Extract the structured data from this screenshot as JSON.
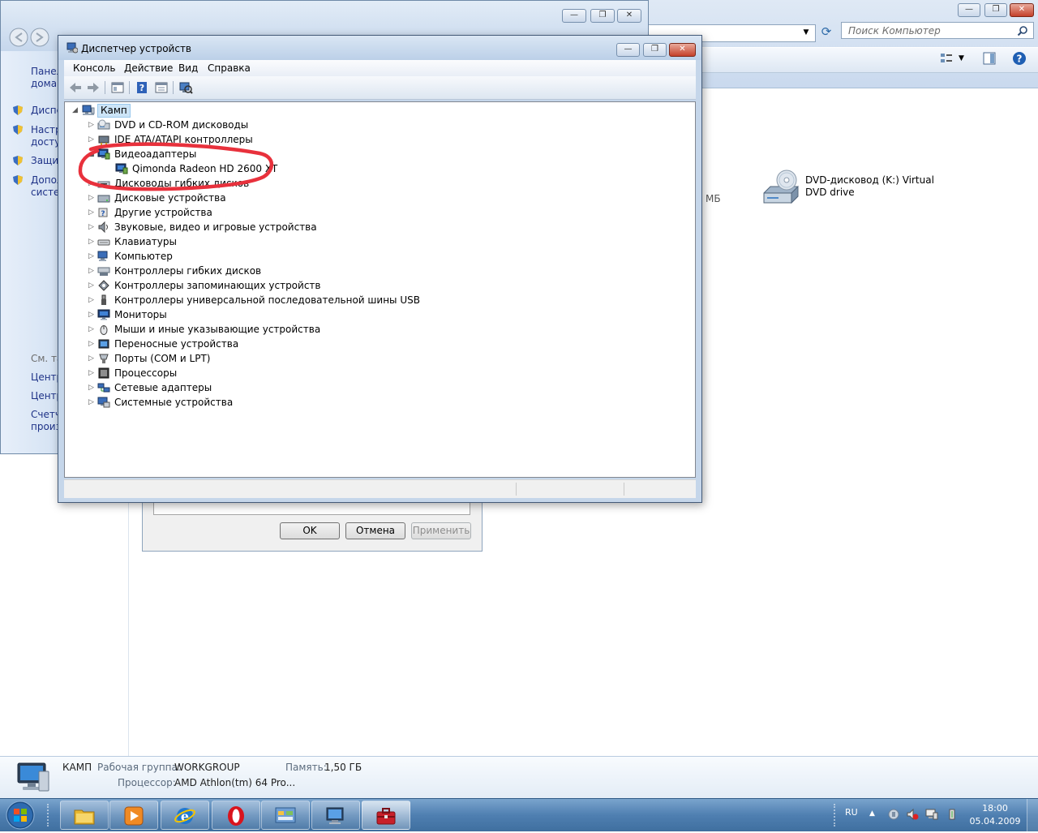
{
  "explorer": {
    "search_placeholder": "Поиск Компьютер",
    "content_mb": "МБ",
    "dvd_label": "DVD-дисковод (K:) Virtual DVD drive",
    "details": {
      "name": "КАМП",
      "workgroup_label": "Рабочая группа:",
      "workgroup_value": "WORKGROUP",
      "memory_label": "Память:",
      "memory_value": "1,50 ГБ",
      "processor_label": "Процессор:",
      "processor_value": "AMD Athlon(tm) 64 Pro..."
    }
  },
  "control_panel": {
    "home_link_1": "Панел",
    "home_link_2": "домаш",
    "links": [
      "Диспе",
      "Настр",
      "досту",
      "Защит",
      "Допол",
      "систем"
    ],
    "see_also": "См. та",
    "see_links": [
      "Центр",
      "Центр",
      "Счетч",
      "произ"
    ]
  },
  "properties": {
    "ok": "OK",
    "cancel": "Отмена",
    "apply": "Применить"
  },
  "device_manager": {
    "title": "Диспетчер устройств",
    "menu": [
      "Консоль",
      "Действие",
      "Вид",
      "Справка"
    ],
    "root": "Камп",
    "items": [
      {
        "label": "DVD и CD-ROM дисководы",
        "icon": "dvd-drive-icon",
        "expanded": false
      },
      {
        "label": "IDE ATA/ATAPI контроллеры",
        "icon": "ide-controller-icon",
        "expanded": false
      },
      {
        "label": "Видеоадаптеры",
        "icon": "display-adapter-icon",
        "expanded": true
      },
      {
        "label": "Qimonda Radeon HD 2600 XT",
        "icon": "display-adapter-icon",
        "child": true
      },
      {
        "label": "Дисководы гибких дисков",
        "icon": "floppy-drive-icon",
        "expanded": false
      },
      {
        "label": "Дисковые устройства",
        "icon": "disk-drive-icon",
        "expanded": false
      },
      {
        "label": "Другие устройства",
        "icon": "unknown-device-icon",
        "expanded": false
      },
      {
        "label": "Звуковые, видео и игровые устройства",
        "icon": "speaker-icon",
        "expanded": false
      },
      {
        "label": "Клавиатуры",
        "icon": "keyboard-icon",
        "expanded": false
      },
      {
        "label": "Компьютер",
        "icon": "computer-icon",
        "expanded": false
      },
      {
        "label": "Контроллеры гибких дисков",
        "icon": "floppy-controller-icon",
        "expanded": false
      },
      {
        "label": "Контроллеры запоминающих устройств",
        "icon": "storage-controller-icon",
        "expanded": false
      },
      {
        "label": "Контроллеры универсальной последовательной шины USB",
        "icon": "usb-icon",
        "expanded": false
      },
      {
        "label": "Мониторы",
        "icon": "monitor-icon",
        "expanded": false
      },
      {
        "label": "Мыши и иные указывающие устройства",
        "icon": "mouse-icon",
        "expanded": false
      },
      {
        "label": "Переносные устройства",
        "icon": "portable-device-icon",
        "expanded": false
      },
      {
        "label": "Порты (COM и LPT)",
        "icon": "port-icon",
        "expanded": false
      },
      {
        "label": "Процессоры",
        "icon": "processor-icon",
        "expanded": false
      },
      {
        "label": "Сетевые адаптеры",
        "icon": "network-adapter-icon",
        "expanded": false
      },
      {
        "label": "Системные устройства",
        "icon": "system-device-icon",
        "expanded": false
      }
    ],
    "annotation_color": "#e8313c"
  },
  "taskbar": {
    "language": "RU",
    "time": "18:00",
    "date": "05.04.2009"
  }
}
